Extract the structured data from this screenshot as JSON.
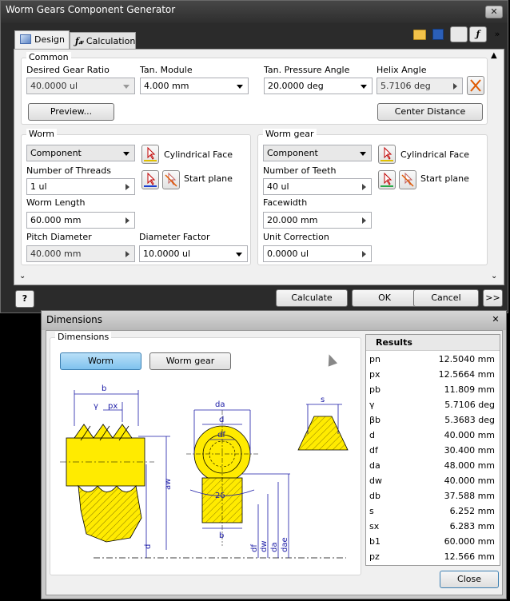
{
  "main_window": {
    "title": "Worm Gears Component Generator",
    "tabs": [
      {
        "label": "Design"
      },
      {
        "label": "Calculation"
      }
    ],
    "common": {
      "title": "Common",
      "desired_ratio_label": "Desired Gear Ratio",
      "desired_ratio_value": "40.0000 ul",
      "tan_module_label": "Tan. Module",
      "tan_module_value": "4.000 mm",
      "pressure_angle_label": "Tan. Pressure Angle",
      "pressure_angle_value": "20.0000 deg",
      "helix_angle_label": "Helix Angle",
      "helix_angle_value": "5.7106 deg",
      "preview_label": "Preview...",
      "center_distance_label": "Center Distance"
    },
    "worm": {
      "title": "Worm",
      "type_value": "Component",
      "cyl_face_label": "Cylindrical Face",
      "threads_label": "Number of Threads",
      "threads_value": "1 ul",
      "start_plane_label": "Start plane",
      "length_label": "Worm Length",
      "length_value": "60.000 mm",
      "pitch_diam_label": "Pitch Diameter",
      "pitch_diam_value": "40.000 mm",
      "diam_factor_label": "Diameter Factor",
      "diam_factor_value": "10.0000 ul"
    },
    "worm_gear": {
      "title": "Worm gear",
      "type_value": "Component",
      "cyl_face_label": "Cylindrical Face",
      "teeth_label": "Number of Teeth",
      "teeth_value": "40 ul",
      "start_plane_label": "Start plane",
      "facewidth_label": "Facewidth",
      "facewidth_value": "20.000 mm",
      "unit_corr_label": "Unit Correction",
      "unit_corr_value": "0.0000 ul"
    },
    "buttons": {
      "calculate": "Calculate",
      "ok": "OK",
      "cancel": "Cancel",
      "more": ">>"
    }
  },
  "dimensions_window": {
    "title": "Dimensions",
    "group_title": "Dimensions",
    "worm_btn": "Worm",
    "worm_gear_btn": "Worm gear",
    "close_btn": "Close",
    "drawing_labels": {
      "b": "b",
      "gamma": "γ",
      "px": "px",
      "da": "da",
      "d": "d",
      "df": "df",
      "s": "s",
      "aw": "aw",
      "two_delta": "2δ",
      "dw": "dw",
      "dae": "dae"
    },
    "results": {
      "title": "Results",
      "rows": [
        {
          "sym": "pn",
          "val": "12.5040 mm"
        },
        {
          "sym": "px",
          "val": "12.5664 mm"
        },
        {
          "sym": "pb",
          "val": "11.809 mm"
        },
        {
          "sym": "γ",
          "val": "5.7106 deg"
        },
        {
          "sym": "βb",
          "val": "5.3683 deg"
        },
        {
          "sym": "d",
          "val": "40.000 mm"
        },
        {
          "sym": "df",
          "val": "30.400 mm"
        },
        {
          "sym": "da",
          "val": "48.000 mm"
        },
        {
          "sym": "dw",
          "val": "40.000 mm"
        },
        {
          "sym": "db",
          "val": "37.588 mm"
        },
        {
          "sym": "s",
          "val": "6.252 mm"
        },
        {
          "sym": "sx",
          "val": "6.283 mm"
        },
        {
          "sym": "b1",
          "val": "60.000 mm"
        },
        {
          "sym": "pz",
          "val": "12.566 mm"
        }
      ]
    }
  },
  "colors": {
    "yellow": "#ffeb00",
    "dim_blue": "#1a1aa6",
    "accent_blue": "#7fc2ee"
  }
}
